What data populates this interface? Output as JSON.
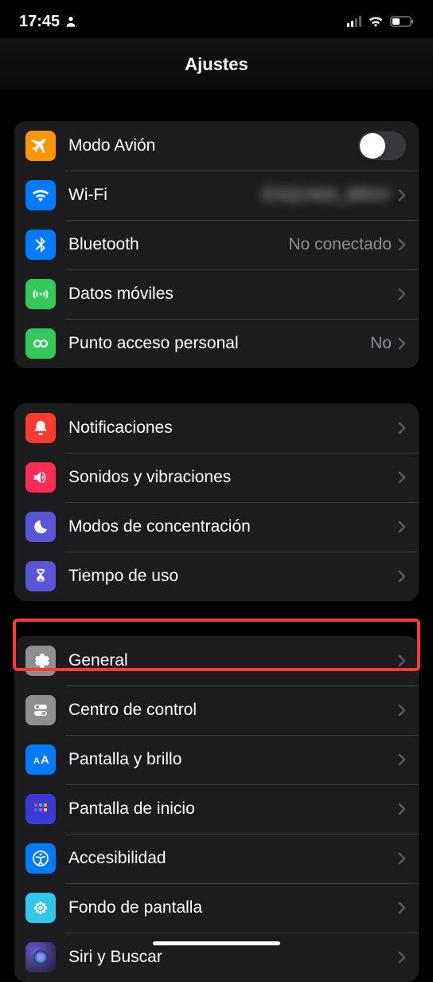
{
  "status": {
    "time": "17:45"
  },
  "header": {
    "title": "Ajustes"
  },
  "groups": [
    {
      "rows": [
        {
          "label": "Modo Avión",
          "detail": "",
          "type": "toggle"
        },
        {
          "label": "Wi-Fi",
          "detail": "ESQUINA_BRAY",
          "blurred": true
        },
        {
          "label": "Bluetooth",
          "detail": "No conectado"
        },
        {
          "label": "Datos móviles",
          "detail": ""
        },
        {
          "label": "Punto acceso personal",
          "detail": "No"
        }
      ]
    },
    {
      "rows": [
        {
          "label": "Notificaciones",
          "detail": ""
        },
        {
          "label": "Sonidos y vibraciones",
          "detail": ""
        },
        {
          "label": "Modos de concentración",
          "detail": ""
        },
        {
          "label": "Tiempo de uso",
          "detail": ""
        }
      ]
    },
    {
      "rows": [
        {
          "label": "General",
          "detail": "",
          "highlighted": true
        },
        {
          "label": "Centro de control",
          "detail": ""
        },
        {
          "label": "Pantalla y brillo",
          "detail": ""
        },
        {
          "label": "Pantalla de inicio",
          "detail": ""
        },
        {
          "label": "Accesibilidad",
          "detail": ""
        },
        {
          "label": "Fondo de pantalla",
          "detail": ""
        },
        {
          "label": "Siri y Buscar",
          "detail": ""
        }
      ]
    }
  ]
}
